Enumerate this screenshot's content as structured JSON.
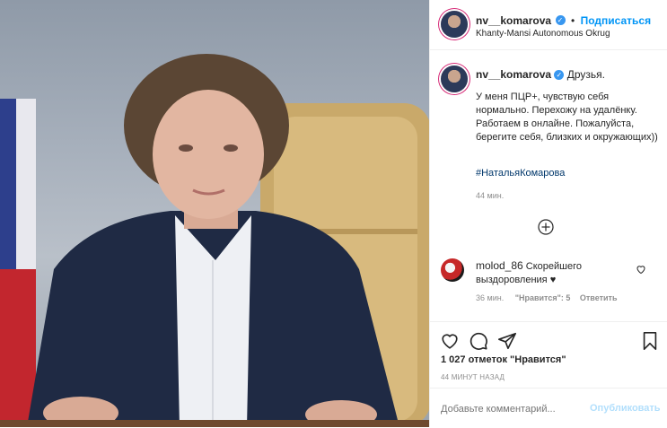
{
  "post": {
    "username": "nv__komarova",
    "follow_label": "Подписаться",
    "separator": "•",
    "location": "Khanty-Mansi Autonomous Okrug"
  },
  "caption": {
    "username": "nv__komarova",
    "first_line": "Друзья.",
    "body": "У меня ПЦР+, чувствую себя нормально. Перехожу на удалёнку. Работаем в онлайне. Пожалуйста, берегите себя, близких и окружающих))",
    "hashtag": "#НатальяКомарова",
    "time": "44 мин."
  },
  "comment": {
    "username": "molod_86",
    "text": "Скорейшего выздоровления",
    "heart": "♥",
    "time": "36 мин.",
    "likes_label": "\"Нравится\": 5",
    "reply_label": "Ответить"
  },
  "stats": {
    "likes": "1 027 отметок \"Нравится\"",
    "posted": "44 МИНУТ НАЗАД"
  },
  "add_comment": {
    "placeholder": "Добавьте комментарий...",
    "publish_label": "Опубликовать"
  },
  "icons": {
    "verified": "verified-badge-icon",
    "like": "heart-outline-icon",
    "comment": "speech-bubble-icon",
    "share": "paper-plane-icon",
    "save": "bookmark-icon",
    "more_comments": "plus-circle-icon",
    "comment_like": "small-heart-icon"
  },
  "colors": {
    "accent": "#0095f6",
    "hashtag": "#00376b",
    "muted": "#8e8e8e",
    "border": "#efefef"
  }
}
